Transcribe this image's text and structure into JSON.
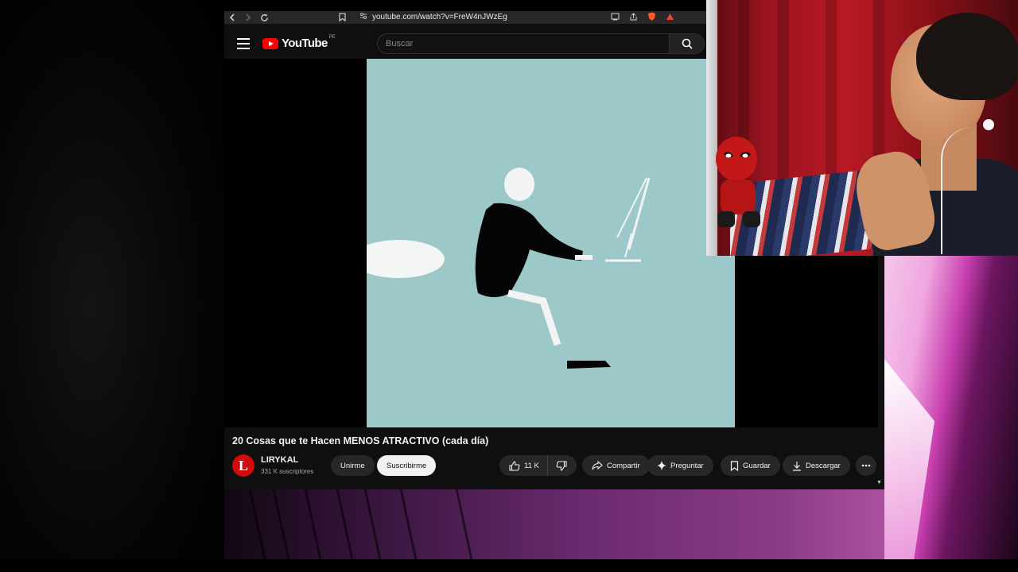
{
  "browser": {
    "url": "youtube.com/watch?v=FreW4nJWzEg"
  },
  "header": {
    "logo_text": "YouTube",
    "country_code": "PE",
    "search_placeholder": "Buscar"
  },
  "video": {
    "title": "20 Cosas que te Hacen MENOS ATRACTIVO (cada día)"
  },
  "channel": {
    "avatar_letter": "L",
    "name": "LIRYKAL",
    "subscribers": "331 K suscriptores",
    "join_label": "Unirme",
    "subscribe_label": "Suscribirme"
  },
  "actions": {
    "like_count": "11 K",
    "share_label": "Compartir",
    "ask_label": "Preguntar",
    "save_label": "Guardar",
    "download_label": "Descargar"
  },
  "icons": {
    "back": "arrow-left-icon",
    "forward": "arrow-right-icon",
    "reload": "reload-icon",
    "bookmark": "bookmark-icon",
    "menu": "hamburger-menu-icon",
    "search": "search-icon",
    "like": "thumbs-up-icon",
    "dislike": "thumbs-down-icon",
    "share": "share-arrow-icon",
    "ask": "sparkle-icon",
    "save": "bookmark-icon",
    "download": "download-icon",
    "more": "more-horizontal-icon"
  },
  "colors": {
    "youtube_red": "#ff0000",
    "video_background": "#9cc8ca",
    "page_background": "#0f0f0f"
  }
}
